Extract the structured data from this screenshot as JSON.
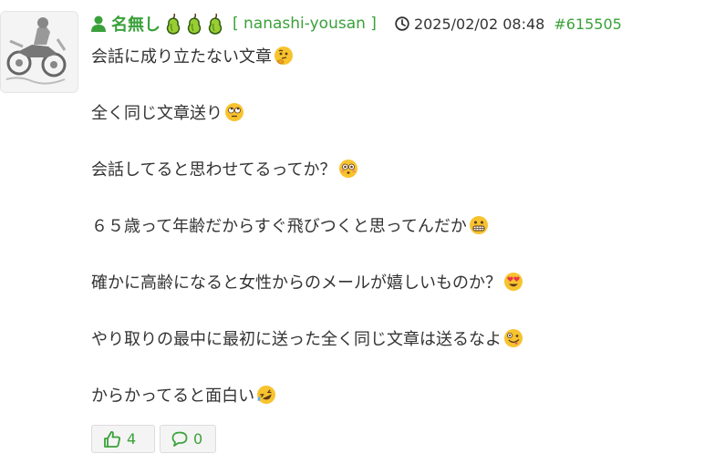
{
  "post": {
    "username": "名無し",
    "user_id": "[ nanashi-yousan ]",
    "timestamp": "2025/02/02 08:48",
    "post_id": "#615505",
    "badge_icons": [
      "pear-icon",
      "pear-icon",
      "pear-icon"
    ],
    "lines": [
      {
        "text": "会話に成り立たない文章",
        "emoji": "thinking-face-emoji"
      },
      {
        "text": "全く同じ文章送り",
        "emoji": "rolling-eyes-emoji"
      },
      {
        "text": "会話してると思わせてるってか？",
        "emoji": "flushed-face-emoji"
      },
      {
        "text": "６５歳って年齢だからすぐ飛びつくと思ってんだか",
        "emoji": "grimacing-face-emoji"
      },
      {
        "text": "確かに高齢になると女性からのメールが嬉しいものか？",
        "emoji": "heart-eyes-emoji"
      },
      {
        "text": "やり取りの最中に最初に送った全く同じ文章は送るなよ",
        "emoji": "zany-face-emoji"
      },
      {
        "text": "からかってると面白い",
        "emoji": "rofl-emoji"
      }
    ],
    "likes": "4",
    "replies": "0"
  },
  "colors": {
    "accent": "#3aa13a",
    "text": "#333333",
    "emoji": "#f7c32e"
  }
}
